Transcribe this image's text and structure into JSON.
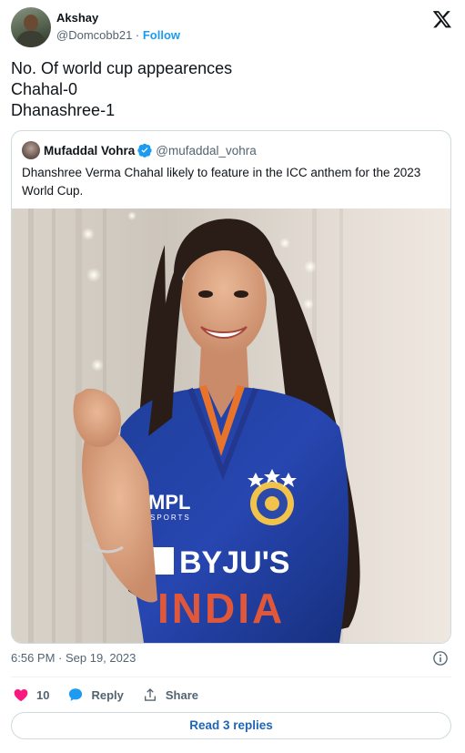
{
  "author": {
    "display_name": "Akshay",
    "handle": "@Domcobb21",
    "separator": " · ",
    "follow_label": "Follow"
  },
  "tweet": {
    "lines": [
      "No. Of world cup appearences",
      "Chahal-0",
      "Dhanashree-1"
    ]
  },
  "quoted_tweet": {
    "display_name": "Mufaddal Vohra",
    "handle": "@mufaddal_vohra",
    "text": "Dhanshree Verma Chahal likely to feature in the ICC anthem for the 2023 World Cup.",
    "photo": {
      "jersey_sponsor": "BYJU'S",
      "jersey_team": "INDIA",
      "jersey_kit_brand": "MPL",
      "jersey_kit_brand_sub": "SPORTS"
    }
  },
  "meta": {
    "timestamp": "6:56 PM · Sep 19, 2023"
  },
  "actions": {
    "like_count": "10",
    "reply_label": "Reply",
    "share_label": "Share"
  },
  "replies_button": {
    "label": "Read 3 replies"
  },
  "colors": {
    "accent": "#1d9bf0",
    "like": "#f91880",
    "muted_text": "#536471",
    "border": "#cfd9de"
  },
  "icons": {
    "platform_logo": "x-logo-icon",
    "verified": "verified-badge-icon",
    "info": "info-icon",
    "like": "heart-icon",
    "reply": "speech-bubble-icon",
    "share": "share-upload-icon"
  }
}
